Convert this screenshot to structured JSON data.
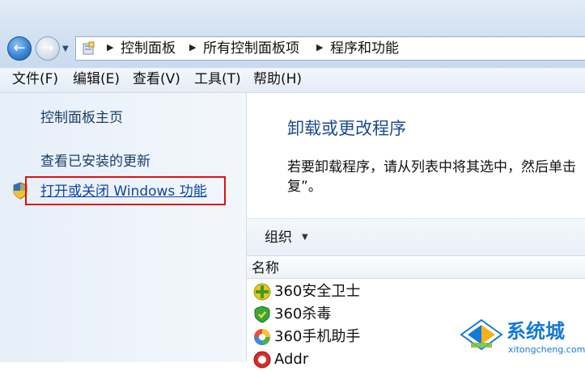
{
  "address_bar": {
    "breadcrumbs": [
      "控制面板",
      "所有控制面板项",
      "程序和功能"
    ]
  },
  "menu": {
    "items": [
      "文件(F)",
      "编辑(E)",
      "查看(V)",
      "工具(T)",
      "帮助(H)"
    ]
  },
  "sidebar": {
    "home": "控制面板主页",
    "updates": "查看已安装的更新",
    "windows_features": "打开或关闭 Windows 功能"
  },
  "main": {
    "title": "卸载或更改程序",
    "description_line1": "若要卸载程序，请从列表中将其选中，然后单击",
    "description_line2": "复”。",
    "organize": "组织",
    "column_name": "名称",
    "programs": [
      {
        "name": "360安全卫士",
        "icon": "360-safeguard-icon"
      },
      {
        "name": "360杀毒",
        "icon": "360-antivirus-icon"
      },
      {
        "name": "360手机助手",
        "icon": "360-mobile-assistant-icon"
      },
      {
        "name": "Addr",
        "icon": "addr-icon"
      }
    ]
  },
  "watermark": {
    "name": "系统城",
    "url": "xitongcheng.com"
  },
  "colors": {
    "highlight_box": "#e01010",
    "link": "#1b3e66",
    "title": "#1c4b8e"
  }
}
